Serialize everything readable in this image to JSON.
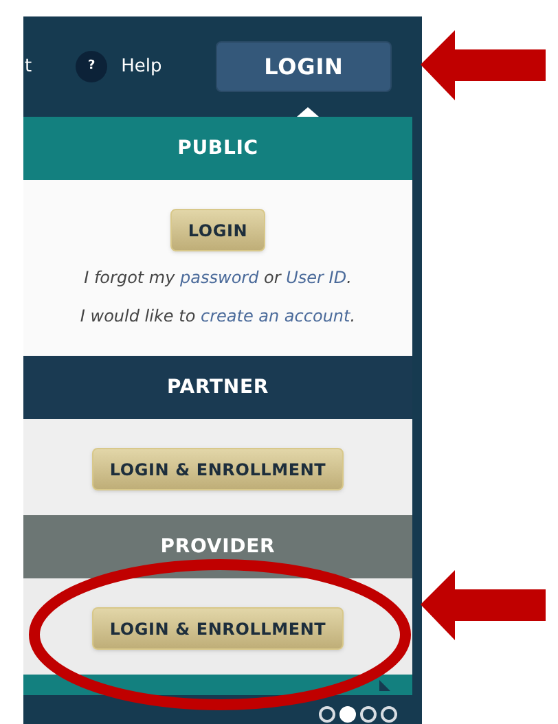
{
  "top_bar": {
    "cut_link": "t",
    "help": {
      "icon_text": "?",
      "label": "Help"
    },
    "login_button": "LOGIN"
  },
  "sections": [
    {
      "kind": "public",
      "header": "PUBLIC",
      "button": "LOGIN",
      "lines": [
        {
          "before": "I forgot my ",
          "link1": "password",
          "middle": " or ",
          "link2": "User ID",
          "after": "."
        },
        {
          "before": "I would like to ",
          "link1": "create an account",
          "after": "."
        }
      ]
    },
    {
      "kind": "partner",
      "header": "PARTNER",
      "button": "LOGIN & ENROLLMENT"
    },
    {
      "kind": "provider",
      "header": "PROVIDER",
      "button": "LOGIN & ENROLLMENT"
    }
  ],
  "carousel_dots": [
    {
      "selected": false
    },
    {
      "selected": true
    },
    {
      "selected": false
    },
    {
      "selected": false
    }
  ]
}
